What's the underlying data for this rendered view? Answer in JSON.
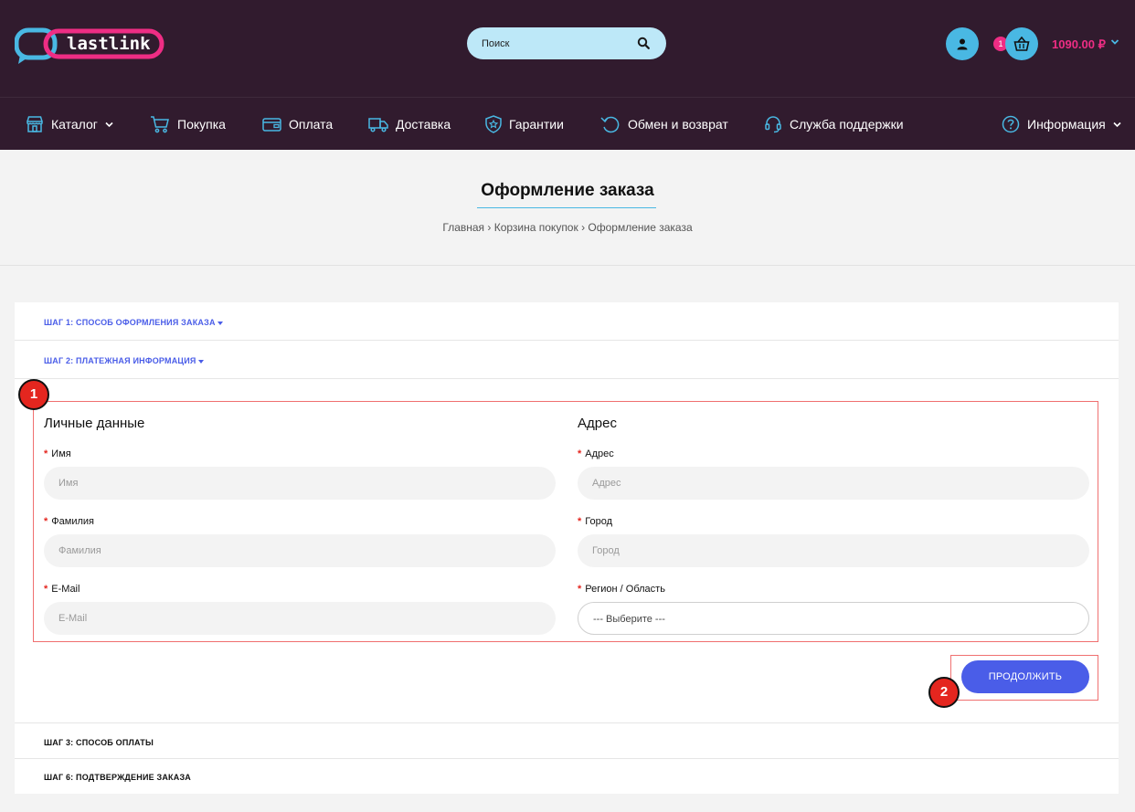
{
  "header": {
    "logo_text": "lastlink",
    "search_placeholder": "Поиск",
    "cart_count": "1",
    "cart_total": "1090.00 ₽"
  },
  "nav": {
    "catalog": "Каталог",
    "purchase": "Покупка",
    "payment": "Оплата",
    "delivery": "Доставка",
    "guarantees": "Гарантии",
    "exchange": "Обмен и возврат",
    "support": "Служба поддержки",
    "info": "Информация"
  },
  "page": {
    "title": "Оформление заказа",
    "breadcrumb": "Главная › Корзина покупок › Оформление заказа"
  },
  "steps": {
    "step1": "Шаг 1: Способ оформления заказа",
    "step2": "Шаг 2: Платежная информация",
    "step3": "Шаг 3: Способ оплаты",
    "step6": "Шаг 6: Подтверждение заказа"
  },
  "personal": {
    "title": "Личные данные",
    "first_name_label": "Имя",
    "first_name_placeholder": "Имя",
    "last_name_label": "Фамилия",
    "last_name_placeholder": "Фамилия",
    "email_label": "E-Mail",
    "email_placeholder": "E-Mail"
  },
  "address": {
    "title": "Адрес",
    "address_label": "Адрес",
    "address_placeholder": "Адрес",
    "city_label": "Город",
    "city_placeholder": "Город",
    "region_label": "Регион / Область",
    "region_value": "--- Выберите ---"
  },
  "actions": {
    "continue": "Продолжить"
  },
  "markers": {
    "m1": "1",
    "m2": "2"
  },
  "colors": {
    "header_bg": "#311b2e",
    "accent_blue": "#4a5de8",
    "accent_pink": "#ee2d84",
    "accent_cyan": "#49b8e3",
    "highlight_red": "#f07070"
  }
}
